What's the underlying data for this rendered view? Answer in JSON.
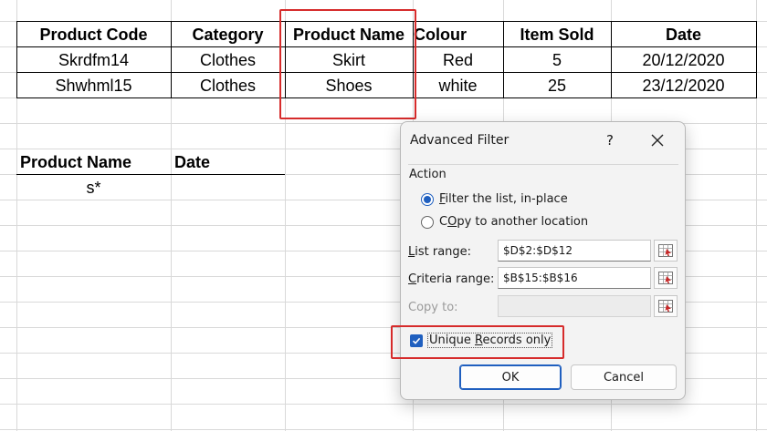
{
  "table": {
    "headers": [
      "Product Code",
      "Category",
      "Product Name",
      "Colour",
      "Item Sold",
      "Date"
    ],
    "rows": [
      [
        "Skrdfm14",
        "Clothes",
        "Skirt",
        "Red",
        "5",
        "20/12/2020"
      ],
      [
        "Shwhml15",
        "Clothes",
        "Shoes",
        "white",
        "25",
        "23/12/2020"
      ]
    ]
  },
  "criteria": {
    "headers": [
      "Product Name",
      "Date"
    ],
    "value": "s*"
  },
  "dialog": {
    "title": "Advanced Filter",
    "help": "?",
    "action_label": "Action",
    "radio_filter_prefix": "",
    "radio_filter_u": "F",
    "radio_filter_rest": "ilter the list, in-place",
    "radio_copy_u": "O",
    "radio_copy_rest_a": "C",
    "radio_copy_rest_b": "py to another location",
    "list_range_u": "L",
    "list_range_rest": "ist range:",
    "list_range_value": "$D$2:$D$12",
    "criteria_range_u": "C",
    "criteria_range_rest": "riteria range:",
    "criteria_range_value": "$B$15:$B$16",
    "copy_to_label": "Copy to:",
    "copy_to_value": "",
    "unique_u": "R",
    "unique_a": "Unique ",
    "unique_b": "ecords only",
    "ok_label": "OK",
    "cancel_label": "Cancel"
  },
  "colors": {
    "accent": "#1f5fbf",
    "highlight": "#d62b2b",
    "grid": "#d9d9d9"
  },
  "icons": [
    "close-icon",
    "range-selector-icon",
    "checkbox-checked-icon"
  ]
}
